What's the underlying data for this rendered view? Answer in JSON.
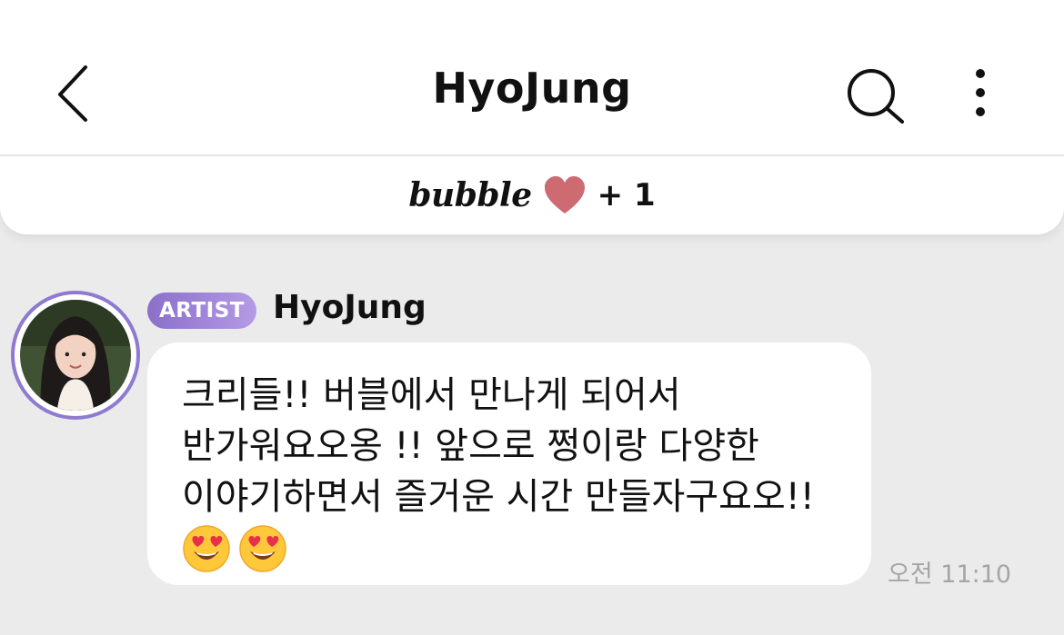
{
  "header": {
    "title": "HyoJung",
    "back_icon": "chevron-left-icon",
    "search_icon": "search-icon",
    "more_icon": "more-vertical-icon"
  },
  "promo": {
    "brand_text": "bubble",
    "heart_icon": "heart-icon",
    "plus_text": "+ 1",
    "heart_color": "#cd6a72"
  },
  "message": {
    "badge": "ARTIST",
    "sender": "HyoJung",
    "lines": [
      "크리들!! 버블에서 만나게 되어서",
      "반가워요오옹 !! 앞으로 쩡이랑 다양한",
      "이야기하면서 즐거운 시간 만들자구요오!!"
    ],
    "emojis": [
      "heart-eyes-emoji",
      "heart-eyes-emoji"
    ],
    "time": "오전 11:10"
  },
  "colors": {
    "background": "#ebebeb",
    "badge_gradient_start": "#8a70c9",
    "badge_gradient_end": "#b59ae6",
    "avatar_ring": "#8f7ad1",
    "timestamp": "#a5a5a5"
  }
}
